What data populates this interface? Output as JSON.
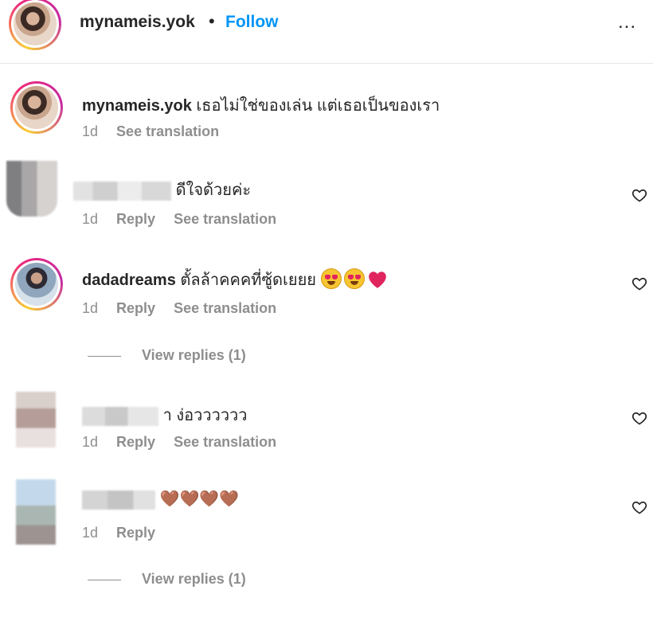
{
  "post_header": {
    "username": "mynameis.yok",
    "separator": "•",
    "follow_label": "Follow",
    "more_label": "..."
  },
  "caption": {
    "username": "mynameis.yok",
    "text": "เธอไม่ใช่ของเล่น แต่เธอเป็นของเรา",
    "time": "1d",
    "see_translation": "See translation"
  },
  "comments": [
    {
      "username": "",
      "text": "ดีใจด้วยค่ะ",
      "time": "1d",
      "reply": "Reply",
      "see_translation": "See translation",
      "username_blurred": true
    },
    {
      "username": "dadadreams",
      "text": "ตั้ลล้าคคคที่ซู้ดเยยย",
      "emoji": [
        "star-struck",
        "star-struck",
        "red-heart"
      ],
      "time": "1d",
      "reply": "Reply",
      "see_translation": "See translation",
      "view_replies": "View replies (1)"
    },
    {
      "username": "",
      "text": "า ง่อวววววว",
      "time": "1d",
      "reply": "Reply",
      "see_translation": "See translation",
      "username_blurred": true
    },
    {
      "username": "",
      "text": "🤎🤎🤎🤎",
      "time": "1d",
      "reply": "Reply",
      "username_blurred": true,
      "view_replies": "View replies (1)"
    }
  ],
  "colors": {
    "accent": "#0095f6",
    "muted": "#8e8e8e",
    "text": "#262626",
    "heart_red": "#e0245e"
  }
}
